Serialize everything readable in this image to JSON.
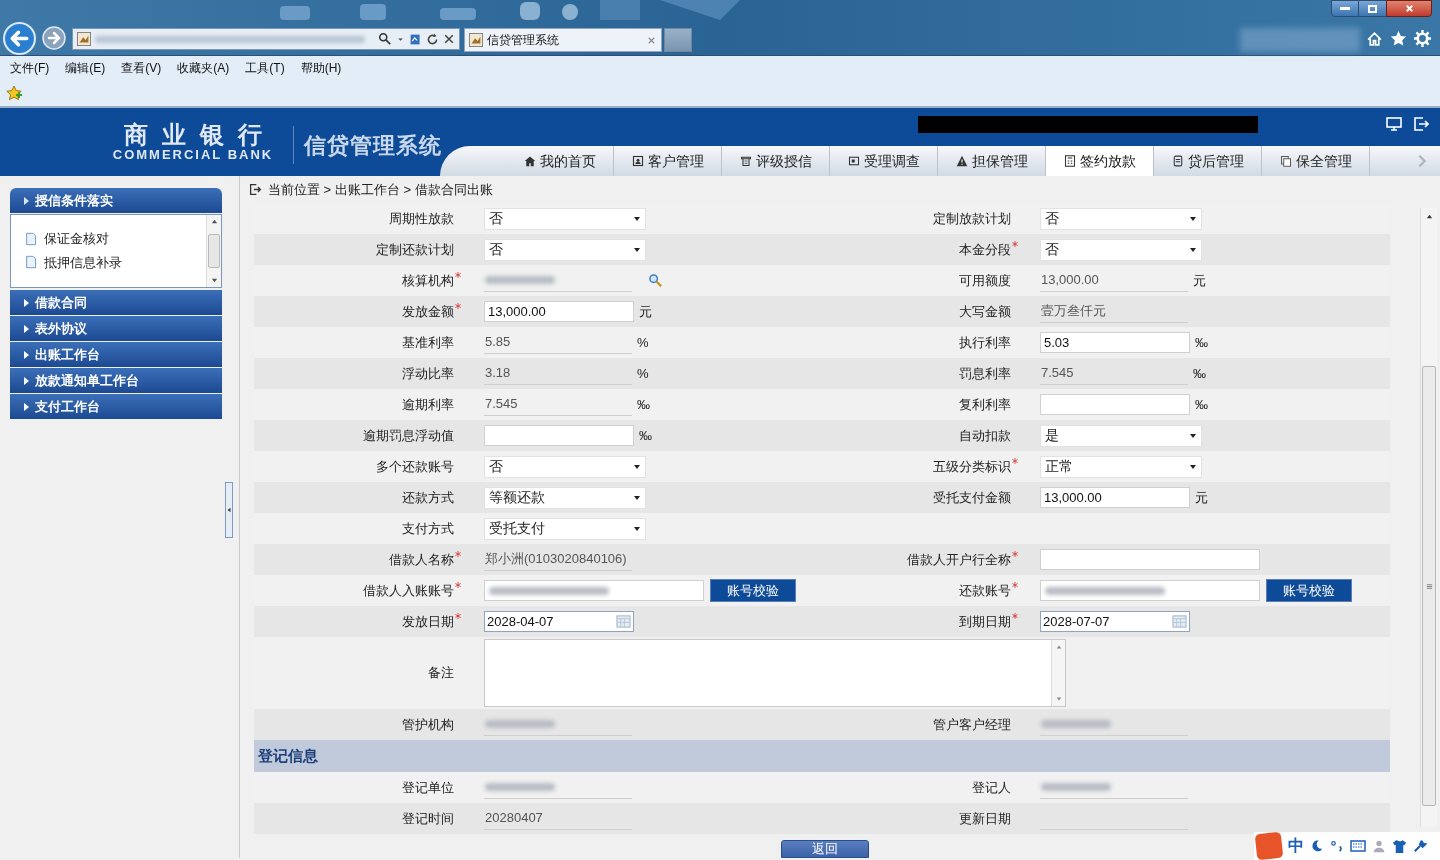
{
  "browser": {
    "tab_title": "信贷管理系统",
    "menu": [
      "文件(F)",
      "编辑(E)",
      "查看(V)",
      "收藏夹(A)",
      "工具(T)",
      "帮助(H)"
    ]
  },
  "header": {
    "logo_cn": "商业银行",
    "logo_en": "COMMERCIAL BANK",
    "system_name": "信贷管理系统"
  },
  "tabs": [
    {
      "label": "我的首页",
      "selected": false
    },
    {
      "label": "客户管理",
      "selected": false
    },
    {
      "label": "评级授信",
      "selected": false
    },
    {
      "label": "受理调查",
      "selected": false
    },
    {
      "label": "担保管理",
      "selected": false
    },
    {
      "label": "签约放款",
      "selected": true
    },
    {
      "label": "贷后管理",
      "selected": false
    },
    {
      "label": "保全管理",
      "selected": false
    }
  ],
  "sidebar": {
    "sections": [
      {
        "label": "授信条件落实",
        "expanded": true,
        "children": [
          "保证金核对",
          "抵押信息补录"
        ]
      },
      {
        "label": "借款合同",
        "expanded": false
      },
      {
        "label": "表外协议",
        "expanded": false
      },
      {
        "label": "出账工作台",
        "expanded": false
      },
      {
        "label": "放款通知单工作台",
        "expanded": false
      },
      {
        "label": "支付工作台",
        "expanded": false
      }
    ]
  },
  "breadcrumb": "当前位置 > 出账工作台 > 借款合同出账",
  "form": {
    "rows": [
      {
        "kind": "fields",
        "left": {
          "label": "周期性放款",
          "required": false,
          "kind": "select",
          "value": "否"
        },
        "right": {
          "label": "定制放款计划",
          "required": false,
          "kind": "select",
          "value": "否"
        }
      },
      {
        "kind": "fields",
        "left": {
          "label": "定制还款计划",
          "required": false,
          "kind": "select",
          "value": "否"
        },
        "right": {
          "label": "本金分段",
          "required": true,
          "kind": "select",
          "value": "否"
        }
      },
      {
        "kind": "fields",
        "left": {
          "label": "核算机构",
          "required": true,
          "kind": "readonly",
          "redacted": true,
          "lookup": true
        },
        "right": {
          "label": "可用额度",
          "required": false,
          "kind": "readonly",
          "value": "13,000.00",
          "unit": "元"
        }
      },
      {
        "kind": "fields",
        "left": {
          "label": "发放金额",
          "required": true,
          "kind": "input",
          "value": "13,000.00",
          "unit": "元"
        },
        "right": {
          "label": "大写金额",
          "required": false,
          "kind": "readonly",
          "value": "壹万叁仟元"
        }
      },
      {
        "kind": "fields",
        "left": {
          "label": "基准利率",
          "required": false,
          "kind": "readonly",
          "value": "5.85",
          "unit": "%"
        },
        "right": {
          "label": "执行利率",
          "required": false,
          "kind": "input",
          "value": "5.03",
          "unit": "‰"
        }
      },
      {
        "kind": "fields",
        "left": {
          "label": "浮动比率",
          "required": false,
          "kind": "readonly",
          "value": "3.18",
          "unit": "%"
        },
        "right": {
          "label": "罚息利率",
          "required": false,
          "kind": "readonly",
          "value": "7.545",
          "unit": "‰"
        }
      },
      {
        "kind": "fields",
        "left": {
          "label": "逾期利率",
          "required": false,
          "kind": "readonly",
          "value": "7.545",
          "unit": "‰"
        },
        "right": {
          "label": "复利利率",
          "required": false,
          "kind": "input",
          "unit": "‰"
        }
      },
      {
        "kind": "fields",
        "left": {
          "label": "逾期罚息浮动值",
          "required": false,
          "kind": "input",
          "unit": "‰"
        },
        "right": {
          "label": "自动扣款",
          "required": false,
          "kind": "select",
          "value": "是"
        }
      },
      {
        "kind": "fields",
        "left": {
          "label": "多个还款账号",
          "required": false,
          "kind": "select",
          "value": "否"
        },
        "right": {
          "label": "五级分类标识",
          "required": true,
          "kind": "select",
          "value": "正常"
        }
      },
      {
        "kind": "fields",
        "left": {
          "label": "还款方式",
          "required": false,
          "kind": "select",
          "value": "等额还款"
        },
        "right": {
          "label": "受托支付金额",
          "required": false,
          "kind": "input",
          "value": "13,000.00",
          "unit": "元"
        }
      },
      {
        "kind": "fields",
        "left": {
          "label": "支付方式",
          "required": false,
          "kind": "select",
          "value": "受托支付"
        }
      },
      {
        "kind": "fields",
        "left": {
          "label": "借款人名称",
          "required": true,
          "kind": "readonly",
          "value": "郑小洲(0103020840106)"
        },
        "right": {
          "label": "借款人开户行全称",
          "required": true,
          "kind": "long_input"
        }
      },
      {
        "kind": "fields",
        "left": {
          "label": "借款人入账账号",
          "required": true,
          "kind": "account",
          "redacted": true,
          "button": "账号校验"
        },
        "right": {
          "label": "还款账号",
          "required": true,
          "kind": "account",
          "redacted": true,
          "button": "账号校验"
        }
      },
      {
        "kind": "fields",
        "left": {
          "label": "发放日期",
          "required": true,
          "kind": "date",
          "value": "2028-04-07"
        },
        "right": {
          "label": "到期日期",
          "required": true,
          "kind": "date",
          "value": "2028-07-07"
        }
      },
      {
        "kind": "textarea",
        "label": "备注"
      },
      {
        "kind": "fields",
        "left": {
          "label": "管护机构",
          "required": false,
          "kind": "readonly",
          "redacted": true
        },
        "right": {
          "label": "管户客户经理",
          "required": false,
          "kind": "readonly",
          "redacted": true
        }
      },
      {
        "kind": "section",
        "title": "登记信息"
      },
      {
        "kind": "fields",
        "left": {
          "label": "登记单位",
          "required": false,
          "kind": "readonly",
          "redacted": true
        },
        "right": {
          "label": "登记人",
          "required": false,
          "kind": "readonly",
          "redacted": true
        }
      },
      {
        "kind": "fields",
        "left": {
          "label": "登记时间",
          "required": false,
          "kind": "readonly",
          "value": "20280407"
        },
        "right": {
          "label": "更新日期",
          "required": false,
          "kind": "readonly"
        }
      }
    ],
    "return_button": "返回"
  },
  "ime": {
    "mode": "中"
  }
}
